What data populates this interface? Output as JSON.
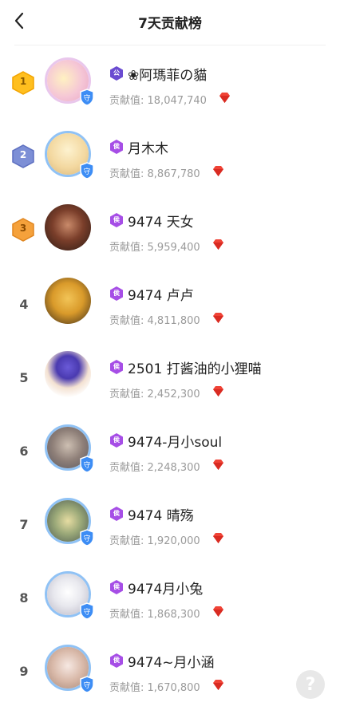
{
  "header": {
    "title": "7天贡献榜",
    "back_icon": "chevron-left-icon"
  },
  "contrib_prefix": "贡献值: ",
  "colors": {
    "guard_blue": "#3d8df5",
    "level_purple": "#a64ee6",
    "level_dark": "#6a4bd1",
    "gem_red": "#f04336",
    "gold": "#ffbf1f",
    "silver": "#7d8fd6",
    "bronze": "#f5a13b"
  },
  "rows": [
    {
      "rank": "1",
      "name": "❀阿瑪菲の貓",
      "value": "18,047,740",
      "level_text": "公"
    },
    {
      "rank": "2",
      "name": "月木木",
      "value": "8,867,780",
      "level_text": "侯"
    },
    {
      "rank": "3",
      "name": "9474 天女",
      "value": "5,959,400",
      "level_text": "侯"
    },
    {
      "rank": "4",
      "name": "9474 卢卢",
      "value": "4,811,800",
      "level_text": "侯"
    },
    {
      "rank": "5",
      "name": "2501 打酱油的小狸喵",
      "value": "2,452,300",
      "level_text": "侯"
    },
    {
      "rank": "6",
      "name": "9474-月小soul",
      "value": "2,248,300",
      "level_text": "侯"
    },
    {
      "rank": "7",
      "name": "9474 晴殇",
      "value": "1,920,000",
      "level_text": "侯"
    },
    {
      "rank": "8",
      "name": "9474月小兔",
      "value": "1,868,300",
      "level_text": "侯"
    },
    {
      "rank": "9",
      "name": "9474~月小涵",
      "value": "1,670,800",
      "level_text": "侯"
    }
  ],
  "help": {
    "label": "?"
  }
}
